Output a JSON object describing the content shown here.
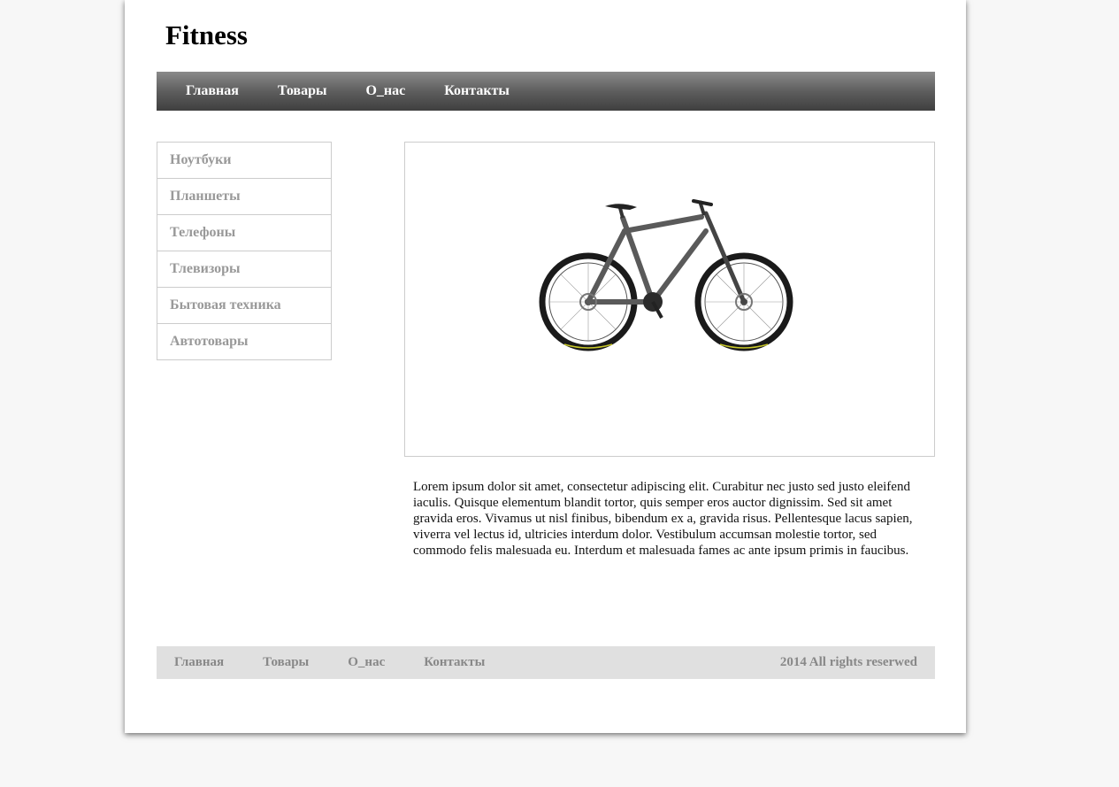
{
  "header": {
    "logo_text": "Fitness"
  },
  "top_nav": {
    "items": [
      {
        "label": "Главная"
      },
      {
        "label": "Товары"
      },
      {
        "label": "О_нас"
      },
      {
        "label": "Контакты"
      }
    ]
  },
  "sidebar": {
    "items": [
      {
        "label": "Ноутбуки"
      },
      {
        "label": "Планшеты"
      },
      {
        "label": "Телефоны"
      },
      {
        "label": "Тлевизоры"
      },
      {
        "label": "Бытовая техника"
      },
      {
        "label": "Автотовары"
      }
    ]
  },
  "product": {
    "image_icon": "bicycle-image",
    "description": "Lorem ipsum dolor sit amet, consectetur adipiscing elit. Curabitur nec justo sed justo eleifend iaculis. Quisque elementum blandit tortor, quis semper eros auctor dignissim. Sed sit amet gravida eros. Vivamus ut nisl finibus, bibendum ex a, gravida risus. Pellentesque lacus sapien, viverra vel lectus id, ultricies interdum dolor. Vestibulum accumsan molestie tortor, sed commodo felis malesuada eu. Interdum et malesuada fames ac ante ipsum primis in faucibus."
  },
  "footer": {
    "items": [
      {
        "label": "Главная"
      },
      {
        "label": "Товары"
      },
      {
        "label": "О_нас"
      },
      {
        "label": "Контакты"
      }
    ],
    "copyright": "2014 All rights reserwed"
  },
  "colors": {
    "nav_gradient_top": "#8a8a8a",
    "nav_gradient_bottom": "#3f3f3f",
    "sidebar_text": "#999999",
    "footer_bg": "#e0e0e0",
    "footer_text": "#888888"
  }
}
